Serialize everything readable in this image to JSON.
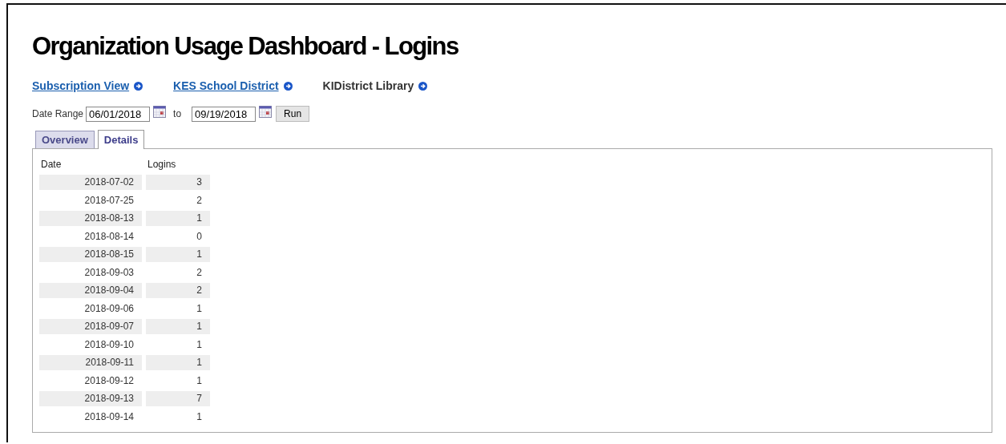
{
  "title": "Organization Usage Dashboard - Logins",
  "breadcrumbs": [
    {
      "label": "Subscription View",
      "link": true
    },
    {
      "label": "KES School District",
      "link": true
    },
    {
      "label": "KIDistrict Library",
      "link": false
    }
  ],
  "date_range": {
    "label": "Date Range",
    "from": "06/01/2018",
    "separator": "to",
    "to": "09/19/2018",
    "run_button": "Run"
  },
  "tabs": [
    {
      "label": "Overview",
      "selected": false
    },
    {
      "label": "Details",
      "selected": true
    }
  ],
  "table": {
    "columns": [
      "Date",
      "Logins"
    ],
    "rows": [
      [
        "2018-07-02",
        "3"
      ],
      [
        "2018-07-25",
        "2"
      ],
      [
        "2018-08-13",
        "1"
      ],
      [
        "2018-08-14",
        "0"
      ],
      [
        "2018-08-15",
        "1"
      ],
      [
        "2018-09-03",
        "2"
      ],
      [
        "2018-09-04",
        "2"
      ],
      [
        "2018-09-06",
        "1"
      ],
      [
        "2018-09-07",
        "1"
      ],
      [
        "2018-09-10",
        "1"
      ],
      [
        "2018-09-11",
        "1"
      ],
      [
        "2018-09-12",
        "1"
      ],
      [
        "2018-09-13",
        "7"
      ],
      [
        "2018-09-14",
        "1"
      ]
    ]
  }
}
